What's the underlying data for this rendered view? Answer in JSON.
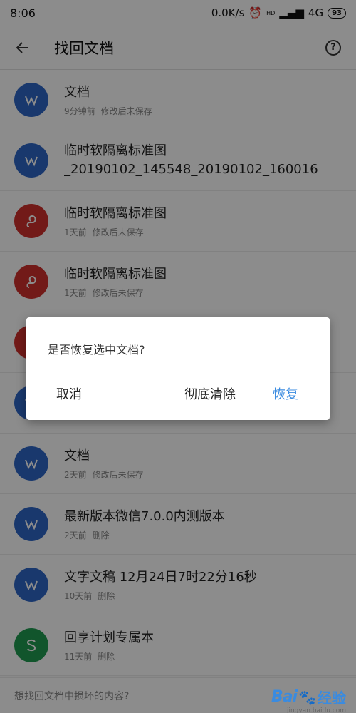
{
  "status_bar": {
    "time": "8:06",
    "net_speed": "0.0K/s",
    "alarm_icon": "alarm-icon",
    "signal_label": "HD",
    "network": "4G",
    "battery": "93"
  },
  "app_bar": {
    "back_icon": "arrow-back-icon",
    "title": "找回文档",
    "help_icon": "question-icon"
  },
  "colors": {
    "word": "#2f66c6",
    "pdf": "#d0312d",
    "sheet": "#1f9b50",
    "accent": "#3a8be0"
  },
  "files": [
    {
      "type": "word",
      "icon": "word-doc-icon",
      "name": "文档",
      "time": "9分钟前",
      "status": "修改后未保存"
    },
    {
      "type": "word",
      "icon": "word-doc-icon",
      "name": "临时软隔离标准图 _20190102_145548_20190102_160016",
      "time": "",
      "status": ""
    },
    {
      "type": "pdf",
      "icon": "pdf-doc-icon",
      "name": "临时软隔离标准图",
      "time": "1天前",
      "status": "修改后未保存"
    },
    {
      "type": "pdf",
      "icon": "pdf-doc-icon",
      "name": "临时软隔离标准图",
      "time": "1天前",
      "status": "修改后未保存"
    },
    {
      "type": "pdf",
      "icon": "pdf-doc-icon",
      "name": "",
      "time": "",
      "status": ""
    },
    {
      "type": "word",
      "icon": "word-doc-icon",
      "name": "",
      "time": "",
      "status": ""
    },
    {
      "type": "word",
      "icon": "word-doc-icon",
      "name": "文档",
      "time": "2天前",
      "status": "修改后未保存"
    },
    {
      "type": "word",
      "icon": "word-doc-icon",
      "name": "最新版本微信7.0.0内测版本",
      "time": "2天前",
      "status": "删除"
    },
    {
      "type": "word",
      "icon": "word-doc-icon",
      "name": "文字文稿 12月24日7时22分16秒",
      "time": "10天前",
      "status": "删除"
    },
    {
      "type": "sheet",
      "icon": "sheet-doc-icon",
      "name": "回享计划专属本",
      "time": "11天前",
      "status": "删除"
    }
  ],
  "footer": {
    "hint": "想找回文档中损坏的内容?"
  },
  "dialog": {
    "message": "是否恢复选中文档?",
    "cancel": "取消",
    "clear": "彻底清除",
    "restore": "恢复"
  },
  "watermark": {
    "logo": "Bai",
    "paw_icon": "paw-icon",
    "text": "经验",
    "url": "jingyan.baidu.com"
  }
}
